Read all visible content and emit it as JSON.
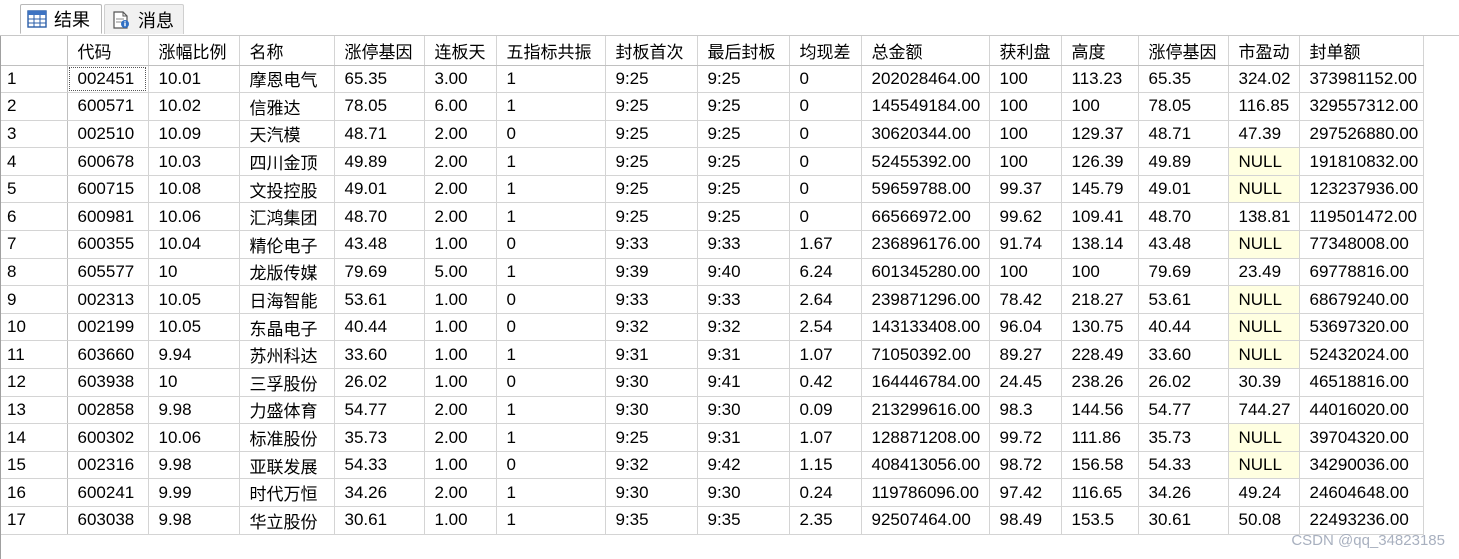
{
  "tabs": [
    {
      "label": "结果",
      "icon": "grid-icon",
      "active": true
    },
    {
      "label": "消息",
      "icon": "message-doc-icon",
      "active": false
    }
  ],
  "colors": {
    "null_cell_bg": "#ffffe1",
    "grid_line": "#d4d4d4",
    "header_border": "#c0c0c0"
  },
  "grid": {
    "columns": [
      "",
      "代码",
      "涨幅比例",
      "名称",
      "涨停基因",
      "连板天",
      "五指标共振",
      "封板首次",
      "最后封板",
      "均现差",
      "总金额",
      "获利盘",
      "高度",
      "涨停基因",
      "市盈动",
      "封单额"
    ],
    "rows": [
      [
        "1",
        "002451",
        "10.01",
        "摩恩电气",
        "65.35",
        "3.00",
        "1",
        "9:25",
        "9:25",
        "0",
        "202028464.00",
        "100",
        "113.23",
        "65.35",
        "324.02",
        "373981152.00"
      ],
      [
        "2",
        "600571",
        "10.02",
        "信雅达",
        "78.05",
        "6.00",
        "1",
        "9:25",
        "9:25",
        "0",
        "145549184.00",
        "100",
        "100",
        "78.05",
        "116.85",
        "329557312.00"
      ],
      [
        "3",
        "002510",
        "10.09",
        "天汽模",
        "48.71",
        "2.00",
        "0",
        "9:25",
        "9:25",
        "0",
        "30620344.00",
        "100",
        "129.37",
        "48.71",
        "47.39",
        "297526880.00"
      ],
      [
        "4",
        "600678",
        "10.03",
        "四川金顶",
        "49.89",
        "2.00",
        "1",
        "9:25",
        "9:25",
        "0",
        "52455392.00",
        "100",
        "126.39",
        "49.89",
        "NULL",
        "191810832.00"
      ],
      [
        "5",
        "600715",
        "10.08",
        "文投控股",
        "49.01",
        "2.00",
        "1",
        "9:25",
        "9:25",
        "0",
        "59659788.00",
        "99.37",
        "145.79",
        "49.01",
        "NULL",
        "123237936.00"
      ],
      [
        "6",
        "600981",
        "10.06",
        "汇鸿集团",
        "48.70",
        "2.00",
        "1",
        "9:25",
        "9:25",
        "0",
        "66566972.00",
        "99.62",
        "109.41",
        "48.70",
        "138.81",
        "119501472.00"
      ],
      [
        "7",
        "600355",
        "10.04",
        "精伦电子",
        "43.48",
        "1.00",
        "0",
        "9:33",
        "9:33",
        "1.67",
        "236896176.00",
        "91.74",
        "138.14",
        "43.48",
        "NULL",
        "77348008.00"
      ],
      [
        "8",
        "605577",
        "10",
        "龙版传媒",
        "79.69",
        "5.00",
        "1",
        "9:39",
        "9:40",
        "6.24",
        "601345280.00",
        "100",
        "100",
        "79.69",
        "23.49",
        "69778816.00"
      ],
      [
        "9",
        "002313",
        "10.05",
        "日海智能",
        "53.61",
        "1.00",
        "0",
        "9:33",
        "9:33",
        "2.64",
        "239871296.00",
        "78.42",
        "218.27",
        "53.61",
        "NULL",
        "68679240.00"
      ],
      [
        "10",
        "002199",
        "10.05",
        "东晶电子",
        "40.44",
        "1.00",
        "0",
        "9:32",
        "9:32",
        "2.54",
        "143133408.00",
        "96.04",
        "130.75",
        "40.44",
        "NULL",
        "53697320.00"
      ],
      [
        "11",
        "603660",
        "9.94",
        "苏州科达",
        "33.60",
        "1.00",
        "1",
        "9:31",
        "9:31",
        "1.07",
        "71050392.00",
        "89.27",
        "228.49",
        "33.60",
        "NULL",
        "52432024.00"
      ],
      [
        "12",
        "603938",
        "10",
        "三孚股份",
        "26.02",
        "1.00",
        "0",
        "9:30",
        "9:41",
        "0.42",
        "164446784.00",
        "24.45",
        "238.26",
        "26.02",
        "30.39",
        "46518816.00"
      ],
      [
        "13",
        "002858",
        "9.98",
        "力盛体育",
        "54.77",
        "2.00",
        "1",
        "9:30",
        "9:30",
        "0.09",
        "213299616.00",
        "98.3",
        "144.56",
        "54.77",
        "744.27",
        "44016020.00"
      ],
      [
        "14",
        "600302",
        "10.06",
        "标准股份",
        "35.73",
        "2.00",
        "1",
        "9:25",
        "9:31",
        "1.07",
        "128871208.00",
        "99.72",
        "111.86",
        "35.73",
        "NULL",
        "39704320.00"
      ],
      [
        "15",
        "002316",
        "9.98",
        "亚联发展",
        "54.33",
        "1.00",
        "0",
        "9:32",
        "9:42",
        "1.15",
        "408413056.00",
        "98.72",
        "156.58",
        "54.33",
        "NULL",
        "34290036.00"
      ],
      [
        "16",
        "600241",
        "9.99",
        "时代万恒",
        "34.26",
        "2.00",
        "1",
        "9:30",
        "9:30",
        "0.24",
        "119786096.00",
        "97.42",
        "116.65",
        "34.26",
        "49.24",
        "24604648.00"
      ],
      [
        "17",
        "603038",
        "9.98",
        "华立股份",
        "30.61",
        "1.00",
        "1",
        "9:35",
        "9:35",
        "2.35",
        "92507464.00",
        "98.49",
        "153.5",
        "30.61",
        "50.08",
        "22493236.00"
      ]
    ]
  },
  "watermark": "CSDN @qq_34823185"
}
